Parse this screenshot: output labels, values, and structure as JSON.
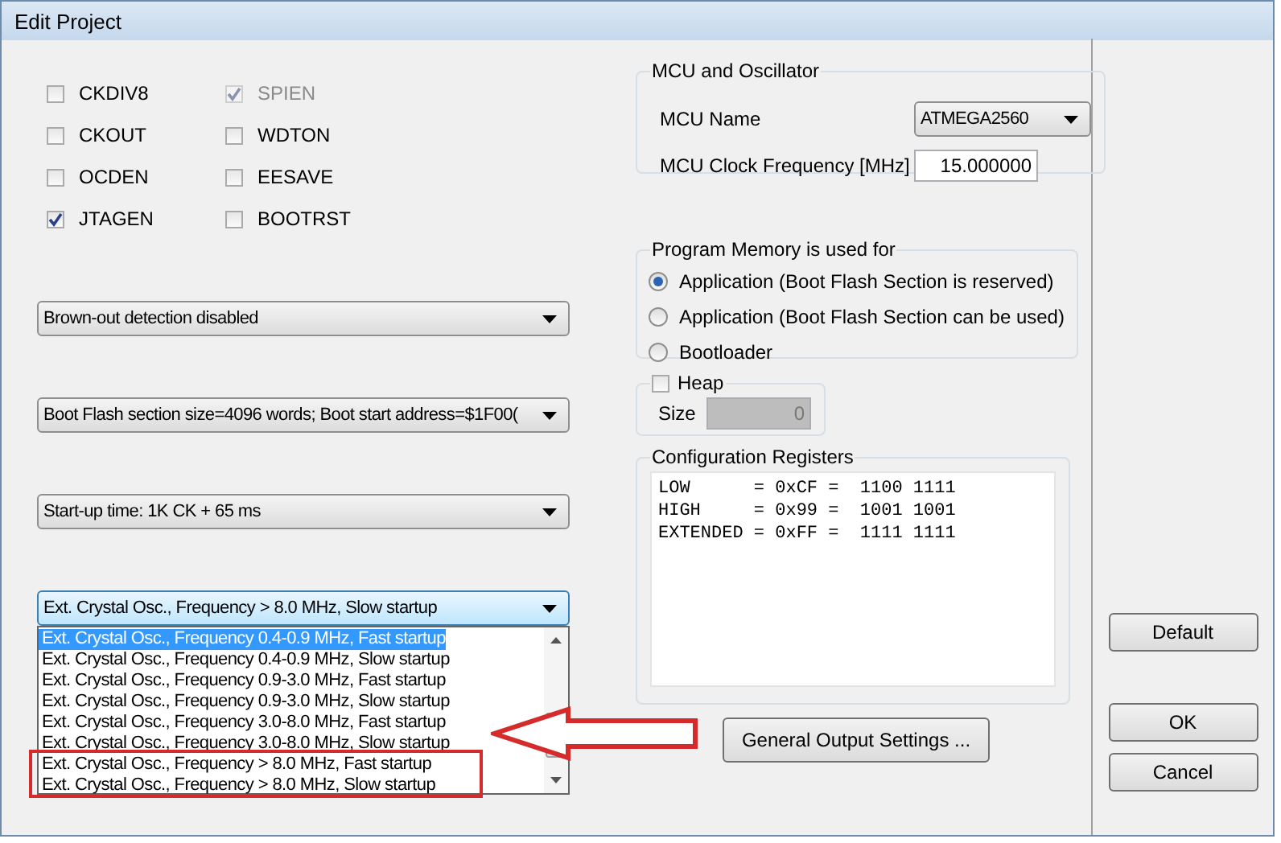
{
  "window": {
    "title": "Edit Project"
  },
  "fuses": [
    {
      "label": "CKDIV8",
      "checked": false,
      "disabled": false
    },
    {
      "label": "SPIEN",
      "checked": true,
      "disabled": true
    },
    {
      "label": "CKOUT",
      "checked": false,
      "disabled": false
    },
    {
      "label": "WDTON",
      "checked": false,
      "disabled": false
    },
    {
      "label": "OCDEN",
      "checked": false,
      "disabled": false
    },
    {
      "label": "EESAVE",
      "checked": false,
      "disabled": false
    },
    {
      "label": "JTAGEN",
      "checked": true,
      "disabled": false
    },
    {
      "label": "BOOTRST",
      "checked": false,
      "disabled": false
    }
  ],
  "dropdowns": [
    {
      "value": "Brown-out detection disabled",
      "focused": false
    },
    {
      "value": "Boot Flash section size=4096 words; Boot start address=$1F00(",
      "focused": false
    },
    {
      "value": "Start-up time: 1K CK + 65 ms",
      "focused": false
    },
    {
      "value": "Ext. Crystal Osc., Frequency > 8.0 MHz, Slow startup",
      "focused": true
    }
  ],
  "open_list": {
    "items": [
      {
        "label": "Ext. Crystal Osc., Frequency 0.4-0.9 MHz, Fast startup",
        "selected": true
      },
      {
        "label": "Ext. Crystal Osc., Frequency 0.4-0.9 MHz, Slow startup",
        "selected": false
      },
      {
        "label": "Ext. Crystal Osc., Frequency 0.9-3.0 MHz, Fast startup",
        "selected": false
      },
      {
        "label": "Ext. Crystal Osc., Frequency 0.9-3.0 MHz, Slow startup",
        "selected": false
      },
      {
        "label": "Ext. Crystal Osc., Frequency 3.0-8.0 MHz, Fast startup",
        "selected": false
      },
      {
        "label": "Ext. Crystal Osc., Frequency 3.0-8.0 MHz, Slow startup",
        "selected": false
      },
      {
        "label": "Ext. Crystal Osc., Frequency > 8.0 MHz, Fast startup",
        "selected": false
      },
      {
        "label": "Ext. Crystal Osc., Frequency > 8.0 MHz, Slow startup",
        "selected": false
      }
    ]
  },
  "mcu_group": {
    "title": "MCU and Oscillator",
    "name_label": "MCU Name",
    "name_value": "ATMEGA2560",
    "clock_label": "MCU Clock Frequency [MHz]",
    "clock_value": "15.000000"
  },
  "memory_group": {
    "title": "Program Memory is used for",
    "options": [
      {
        "label": "Application (Boot Flash Section is reserved)",
        "selected": true
      },
      {
        "label": "Application (Boot Flash Section can be used)",
        "selected": false
      },
      {
        "label": "Bootloader",
        "selected": false
      }
    ]
  },
  "heap_group": {
    "title": "Heap",
    "checked": false,
    "size_label": "Size",
    "size_value": "0"
  },
  "config_group": {
    "title": "Configuration Registers",
    "lines": [
      "LOW      = 0xCF =  1100 1111",
      "HIGH     = 0x99 =  1001 1001",
      "EXTENDED = 0xFF =  1111 1111"
    ]
  },
  "output_button": "General Output Settings ...",
  "side_buttons": [
    {
      "label": "Default"
    },
    {
      "label": "OK"
    },
    {
      "label": "Cancel"
    }
  ]
}
